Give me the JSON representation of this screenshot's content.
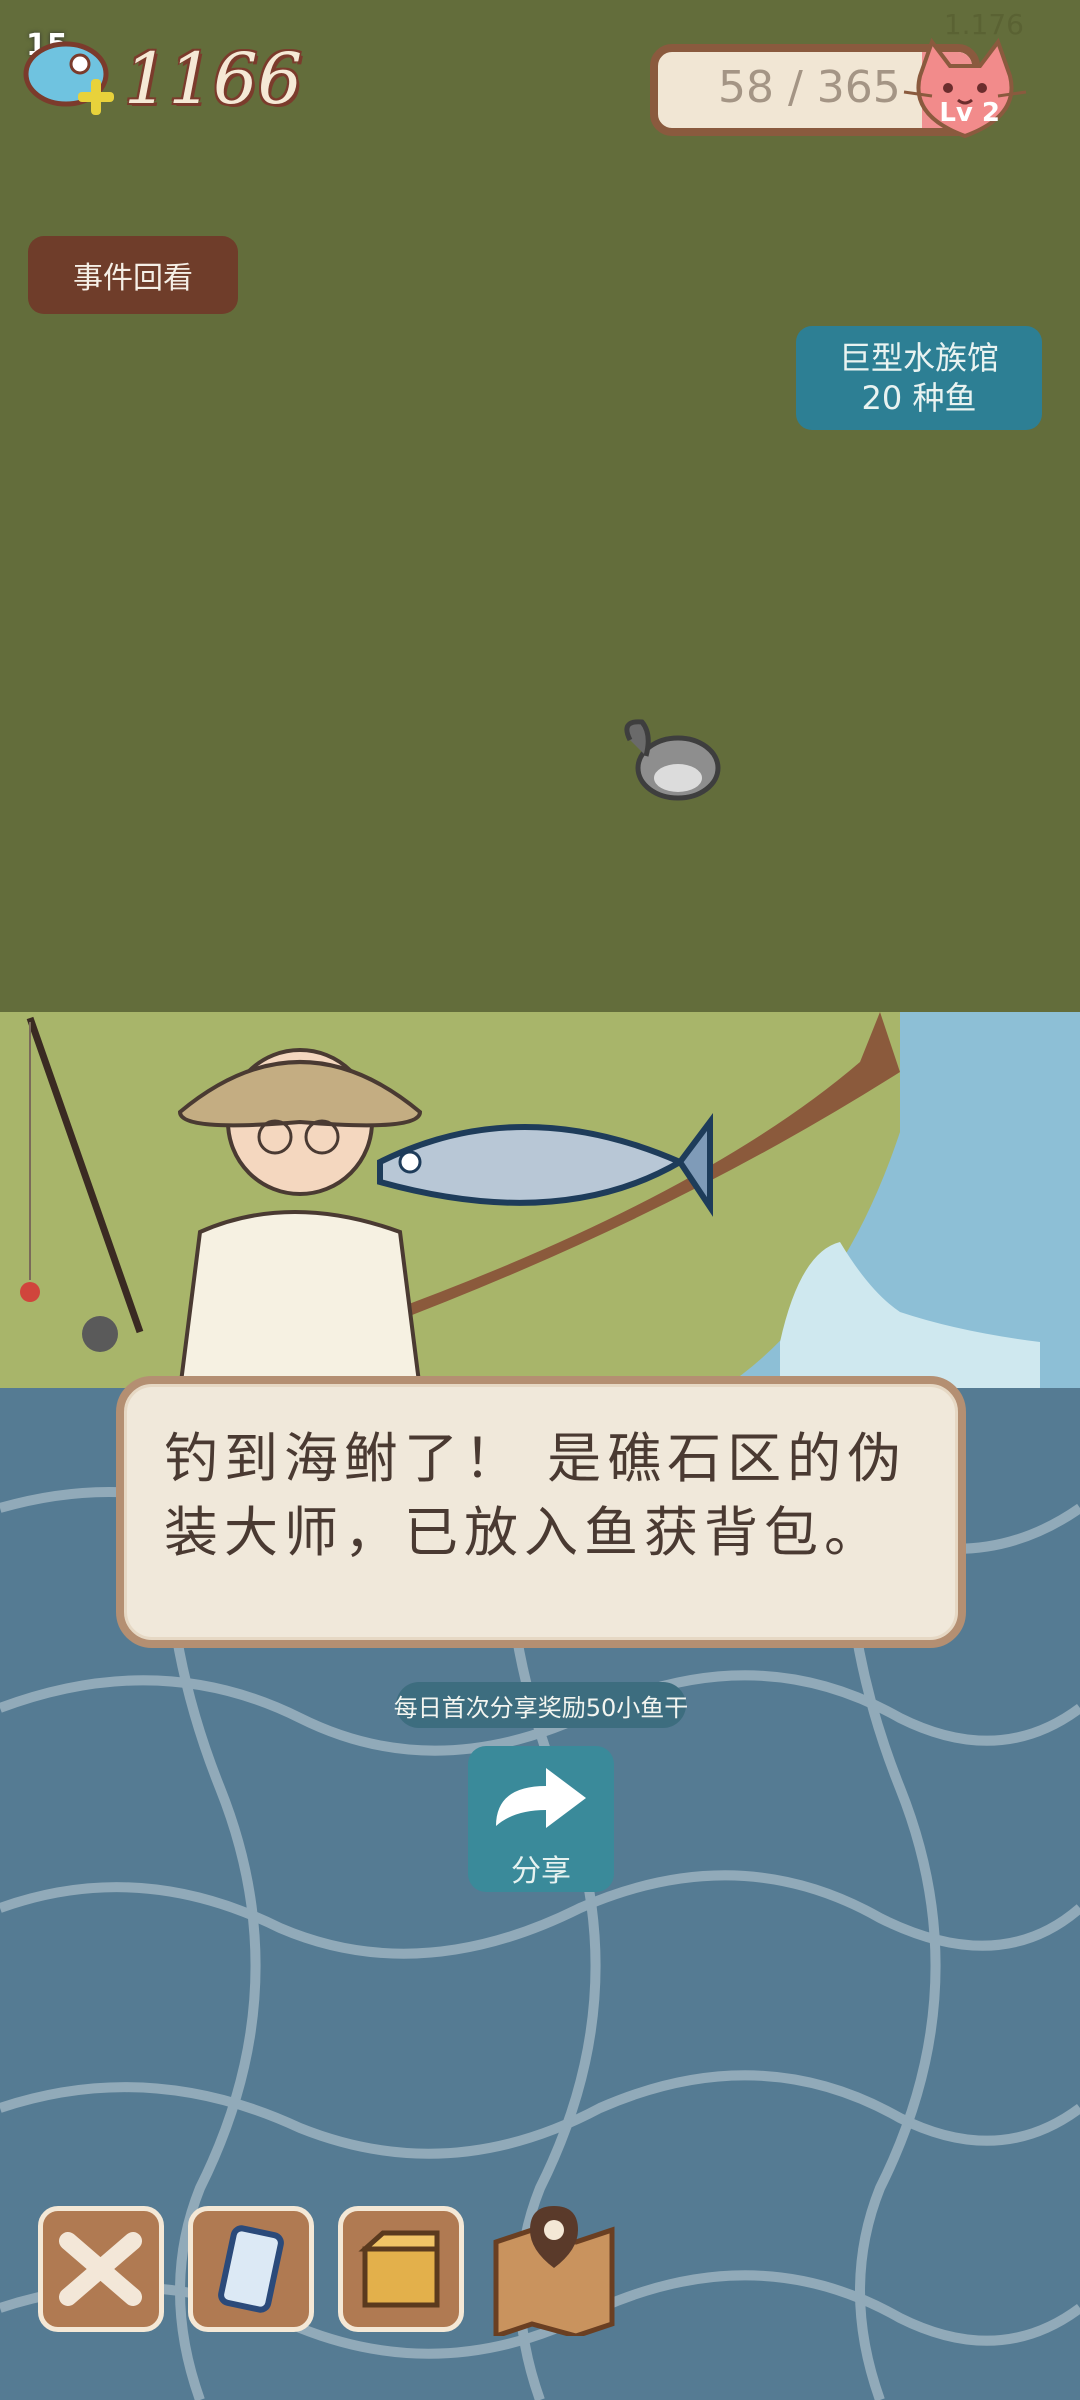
{
  "hud": {
    "version": "1.176",
    "level": "15",
    "currency_value": "1166",
    "xp_text": "58 / 365",
    "xp_progress": 0.159,
    "cat_level": "Lv 2"
  },
  "buttons": {
    "events": "事件回看",
    "aquarium_line1": "巨型水族馆",
    "aquarium_line2": "20 种鱼"
  },
  "dialog": {
    "line1": "钓到海鲋了！ 是礁石区的伪",
    "line2": "装大师，已放入鱼获背包。"
  },
  "share": {
    "note": "每日首次分享奖励50小鱼干",
    "label": "分享"
  },
  "dock": {
    "icons": [
      "crossed-tools-icon",
      "phone-icon",
      "box-icon",
      "map-icon"
    ]
  },
  "colors": {
    "background_top": "#636d3b",
    "water": "#557b93",
    "events_button": "#6f3d2a",
    "aquarium_button": "#2d7f94",
    "share_button": "#3a8a9a",
    "dialog_bg": "#f0e8da"
  }
}
